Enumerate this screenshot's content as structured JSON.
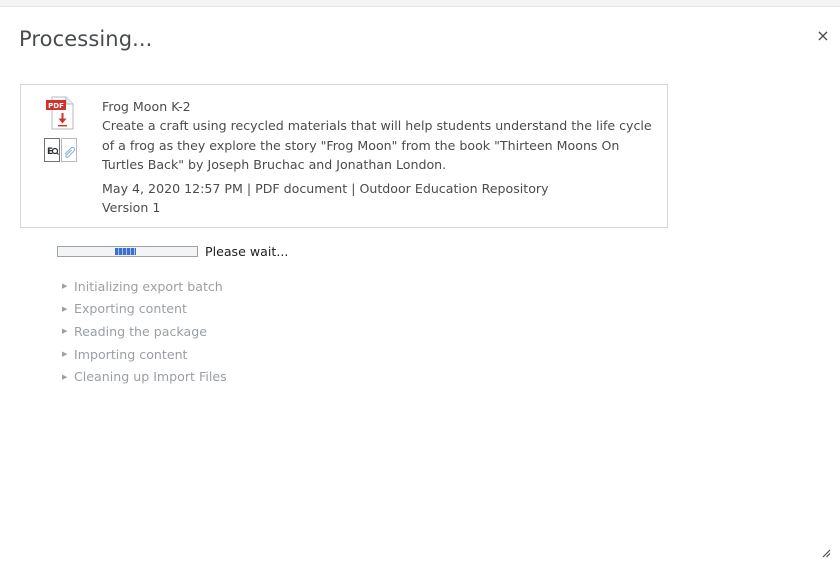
{
  "dialog": {
    "title": "Processing...",
    "close_label": "×"
  },
  "item": {
    "title": "Frog Moon K-2",
    "description": "Create a craft using recycled materials that will help students understand the life cycle of a frog as they explore the story \"Frog Moon\" from the book \"Thirteen Moons On Turtles Back\" by Joseph Bruchac and Jonathan London.",
    "meta": "May 4, 2020 12:57 PM | PDF document | Outdoor Education Repository",
    "version": "Version 1",
    "file_badge": "PDF",
    "icon": "pdf-document-icon"
  },
  "progress": {
    "label": "Please wait..."
  },
  "steps": [
    {
      "label": "Initializing export batch"
    },
    {
      "label": "Exporting content"
    },
    {
      "label": "Reading the package"
    },
    {
      "label": "Importing content"
    },
    {
      "label": "Cleaning up Import Files"
    }
  ],
  "colors": {
    "pdf_red": "#d0332a",
    "progress_blue": "#3a6fd8",
    "step_gray": "#9a9fa4",
    "text": "#494c4e"
  }
}
